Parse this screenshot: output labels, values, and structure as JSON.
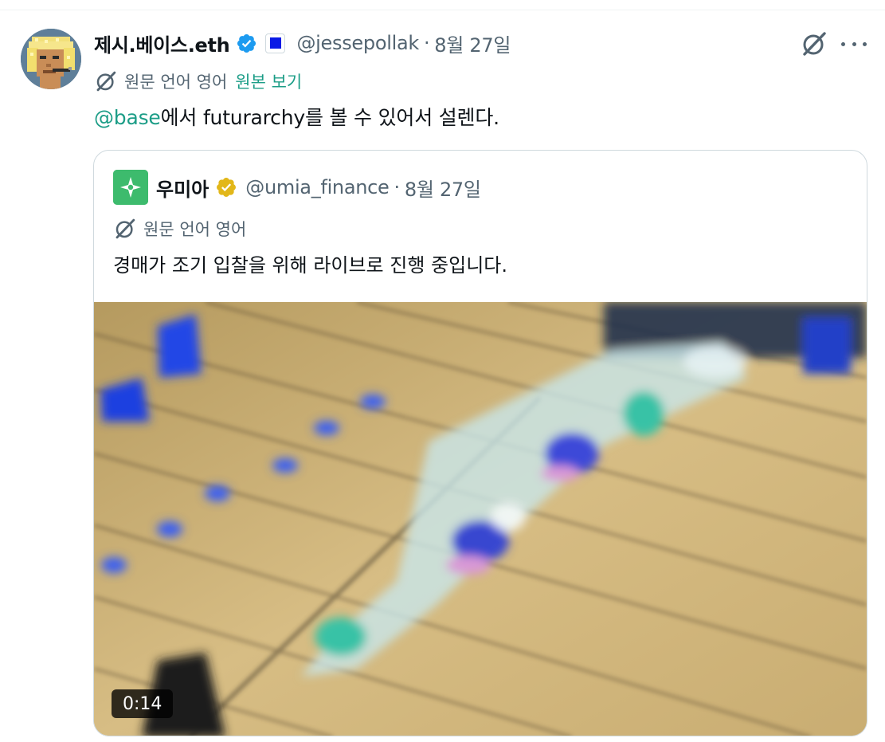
{
  "tweet": {
    "author": {
      "display_name": "제시.베이스.eth",
      "handle": "@jessepollak",
      "verified_icon": "verified-badge-icon",
      "affiliation_icon": "affiliate-square-icon"
    },
    "separator": "·",
    "date": "8월 27일",
    "translation": {
      "label": "원문 언어 영어",
      "show_original": "원본 보기"
    },
    "text": {
      "mention": "@base",
      "body": "에서 futurarchy를 볼 수 있어서 설렌다."
    },
    "actions": {
      "grok_icon": "grok-icon",
      "more_icon": "more-icon"
    }
  },
  "quote": {
    "author": {
      "display_name": "우미아",
      "handle": "@umia_finance",
      "verified_icon": "gold-verified-badge-icon"
    },
    "separator": "·",
    "date": "8월 27일",
    "translation": {
      "label": "원문 언어 영어"
    },
    "text": "경매가 조기 입찰을 위해 라이브로 진행 중입니다.",
    "media": {
      "type": "video",
      "duration": "0:14"
    }
  },
  "colors": {
    "link": "#1c9d87",
    "secondary_text": "#536471",
    "verified_blue": "#1d9bf0",
    "verified_gold": "#e2b719",
    "affiliate_square": "#0a1ae6",
    "quote_avatar_green": "#3dbb6d"
  }
}
